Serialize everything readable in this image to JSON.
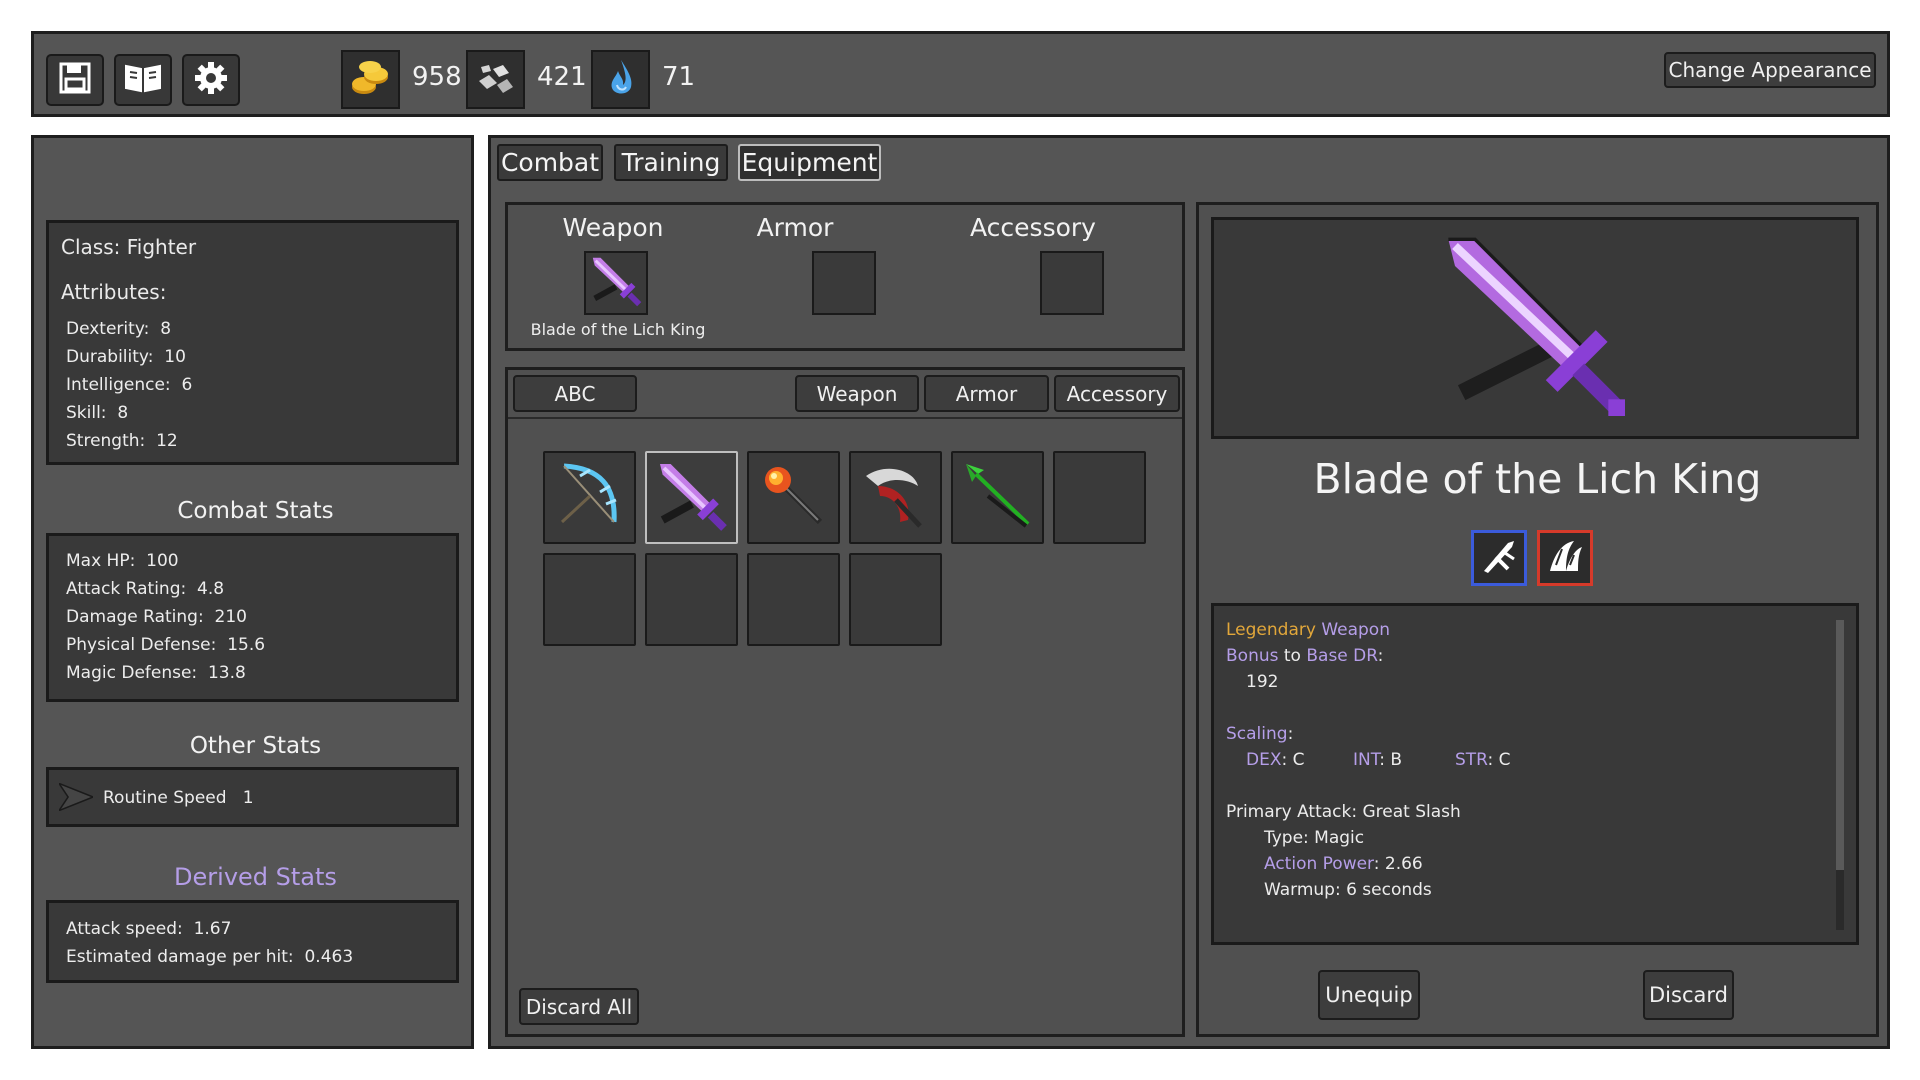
{
  "topbar": {
    "tools": [
      {
        "icon": "save-icon"
      },
      {
        "icon": "book-icon"
      },
      {
        "icon": "gear-icon"
      }
    ],
    "resources": [
      {
        "icon": "gold-coins-icon",
        "value": "958"
      },
      {
        "icon": "stone-ore-icon",
        "value": "421"
      },
      {
        "icon": "water-essence-icon",
        "value": "71"
      }
    ],
    "change_appearance": "Change Appearance"
  },
  "character": {
    "class_line": "Class: Fighter",
    "attributes_title": "Attributes:",
    "attributes": [
      {
        "label": "Dexterity:",
        "value": "8"
      },
      {
        "label": "Durability:",
        "value": "10"
      },
      {
        "label": "Intelligence:",
        "value": "6"
      },
      {
        "label": "Skill:",
        "value": "8"
      },
      {
        "label": "Strength:",
        "value": "12"
      }
    ],
    "combat_title": "Combat Stats",
    "combat": [
      {
        "label": "Max HP:",
        "value": "100"
      },
      {
        "label": "Attack Rating:",
        "value": "4.8"
      },
      {
        "label": "Damage Rating:",
        "value": "210"
      },
      {
        "label": "Physical Defense:",
        "value": "15.6"
      },
      {
        "label": "Magic Defense:",
        "value": "13.8"
      }
    ],
    "other_title": "Other Stats",
    "other": [
      {
        "icon": "routine-speed-icon",
        "label": "Routine Speed",
        "value": "1"
      }
    ],
    "derived_title": "Derived Stats",
    "derived": [
      {
        "label": "Attack speed:",
        "value": "1.67"
      },
      {
        "label": "Estimated damage per hit:",
        "value": "0.463"
      }
    ]
  },
  "tabs": [
    {
      "label": "Combat",
      "active": false
    },
    {
      "label": "Training",
      "active": false
    },
    {
      "label": "Equipment",
      "active": true
    }
  ],
  "equipped": {
    "weapon_label": "Weapon",
    "weapon_item": "Blade of the Lich King",
    "armor_label": "Armor",
    "accessory_label": "Accessory"
  },
  "inventory": {
    "sort_label": "ABC",
    "filters": [
      "Weapon",
      "Armor",
      "Accessory"
    ],
    "items": [
      {
        "icon": "ice-bow-icon"
      },
      {
        "icon": "purple-sword-icon",
        "selected": true
      },
      {
        "icon": "fire-staff-icon"
      },
      {
        "icon": "crimson-scythe-icon"
      },
      {
        "icon": "green-spear-icon"
      },
      {
        "icon": ""
      },
      {
        "icon": ""
      },
      {
        "icon": ""
      },
      {
        "icon": ""
      },
      {
        "icon": ""
      }
    ],
    "discard_all": "Discard All"
  },
  "details": {
    "name": "Blade of the Lich King",
    "trait_icons": [
      "blade-trait-icon",
      "magic-trait-icon"
    ],
    "rarity": "Legendary",
    "item_type": "Weapon",
    "bonus_word": "Bonus",
    "bonus_to": "to",
    "base_dr": "Base DR",
    "bonus_value": "192",
    "scaling_label": "Scaling",
    "scaling": [
      {
        "stat": "DEX",
        "grade": "C"
      },
      {
        "stat": "INT",
        "grade": "B"
      },
      {
        "stat": "STR",
        "grade": "C"
      }
    ],
    "primary_attack": "Primary Attack: Great Slash",
    "type_line": "Type: Magic",
    "action_power_label": "Action Power",
    "action_power_value": "2.66",
    "warmup_line": "Warmup: 6 seconds",
    "unequip": "Unequip",
    "discard": "Discard"
  },
  "colors": {
    "panel": "#555555",
    "inset": "#393939",
    "purple_text": "#b59ee8",
    "legendary": "#e2a73a",
    "trait_blue": "#3b5bdb",
    "trait_red": "#d63a2a"
  }
}
